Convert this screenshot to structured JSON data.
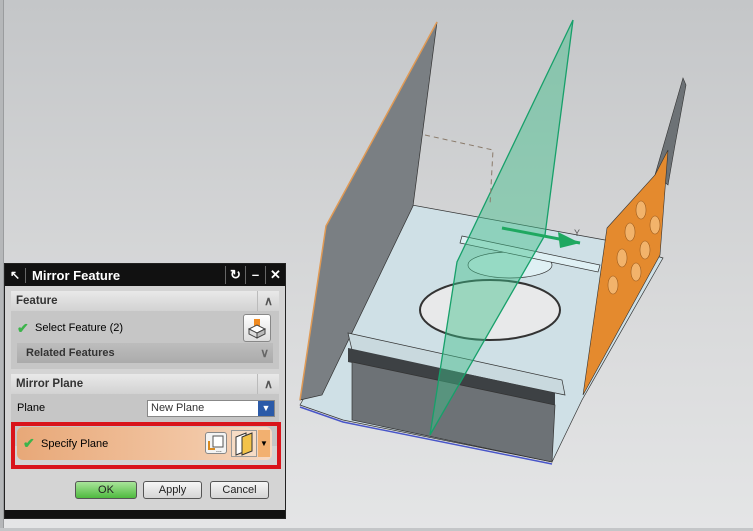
{
  "dialog": {
    "title": "Mirror Feature",
    "feature_section": {
      "header": "Feature",
      "select_label": "Select Feature (2)",
      "related": "Related Features"
    },
    "mirror_plane_section": {
      "header": "Mirror Plane",
      "plane_label": "Plane",
      "plane_value": "New Plane",
      "specify_label": "Specify Plane"
    },
    "buttons": {
      "ok": "OK",
      "apply": "Apply",
      "cancel": "Cancel"
    },
    "icons": {
      "pin": "pin-icon",
      "reset": "reset-icon",
      "minimize": "minimize-icon",
      "close": "close-icon"
    }
  },
  "model": {
    "axis_label": "Y",
    "colors": {
      "plate": "#cfe0e6",
      "wall": "#6f7478",
      "orange_face": "#e48a2e",
      "mirror_plane": "#3fbf8a",
      "highlight": "#d9141b"
    }
  }
}
